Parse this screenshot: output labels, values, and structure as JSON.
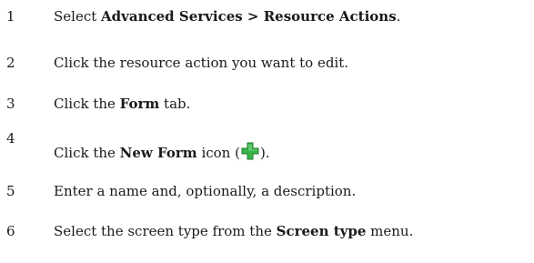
{
  "steps": [
    {
      "number": "1",
      "text_before": "Select ",
      "bold": "Advanced Services > Resource Actions",
      "text_after": "."
    },
    {
      "number": "2",
      "text": "Click the resource action you want to edit."
    },
    {
      "number": "3",
      "text_before": "Click the ",
      "bold": "Form",
      "text_after": " tab."
    },
    {
      "number": "4",
      "text_before": "Click the ",
      "bold": "New Form",
      "text_mid": " icon (",
      "icon": "green-plus-icon",
      "text_after": ")."
    },
    {
      "number": "5",
      "text": "Enter a name and, optionally, a description."
    },
    {
      "number": "6",
      "text_before": "Select the screen type from the ",
      "bold": "Screen type",
      "text_after": " menu."
    }
  ],
  "colors": {
    "plus_icon": "#39b54a",
    "text": "#1a1a1a"
  }
}
